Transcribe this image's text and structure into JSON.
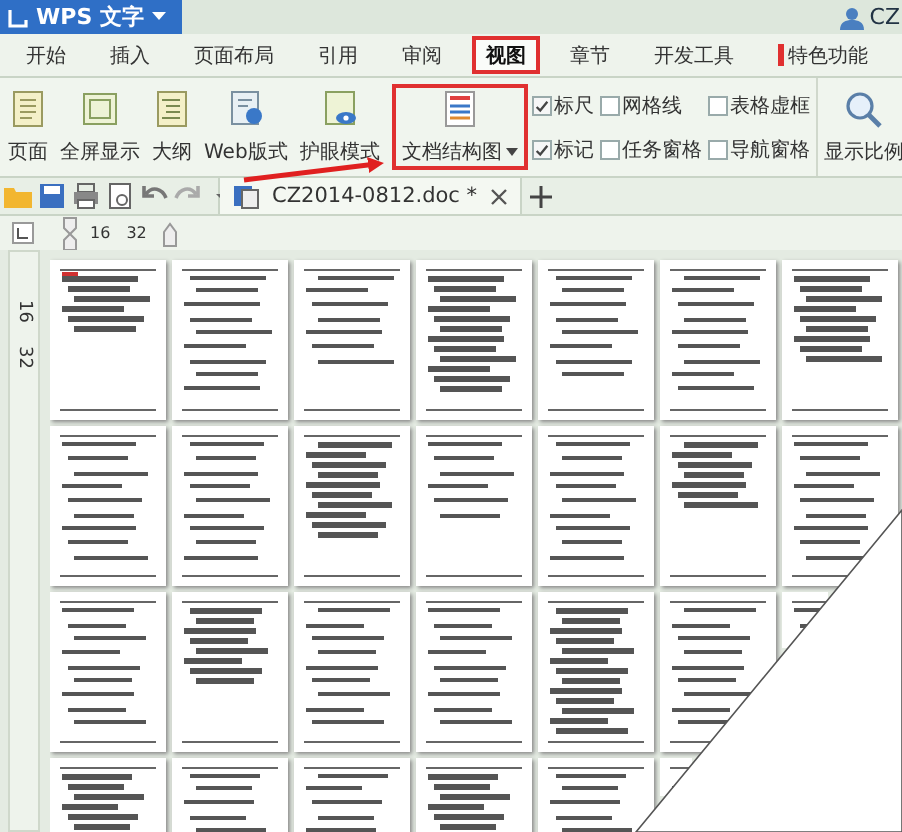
{
  "app": {
    "title": "WPS 文字",
    "user": "CZ"
  },
  "menu_tabs": [
    {
      "label": "开始",
      "selected": false,
      "highlighted": false,
      "flagged": false
    },
    {
      "label": "插入",
      "selected": false,
      "highlighted": false,
      "flagged": false
    },
    {
      "label": "页面布局",
      "selected": false,
      "highlighted": false,
      "flagged": false
    },
    {
      "label": "引用",
      "selected": false,
      "highlighted": false,
      "flagged": false
    },
    {
      "label": "审阅",
      "selected": false,
      "highlighted": false,
      "flagged": false
    },
    {
      "label": "视图",
      "selected": true,
      "highlighted": true,
      "flagged": false
    },
    {
      "label": "章节",
      "selected": false,
      "highlighted": false,
      "flagged": false
    },
    {
      "label": "开发工具",
      "selected": false,
      "highlighted": false,
      "flagged": false
    },
    {
      "label": "特色功能",
      "selected": false,
      "highlighted": false,
      "flagged": true
    }
  ],
  "ribbon": {
    "buttons": [
      {
        "label": "页面",
        "highlighted": false
      },
      {
        "label": "全屏显示",
        "highlighted": false
      },
      {
        "label": "大纲",
        "highlighted": false
      },
      {
        "label": "Web版式",
        "highlighted": false
      },
      {
        "label": "护眼模式",
        "highlighted": false
      },
      {
        "label": "文档结构图",
        "highlighted": true
      }
    ],
    "checkboxes": [
      {
        "label": "标尺",
        "checked": true
      },
      {
        "label": "网格线",
        "checked": false
      },
      {
        "label": "表格虚框",
        "checked": false
      },
      {
        "label": "标记",
        "checked": true
      },
      {
        "label": "任务窗格",
        "checked": false
      },
      {
        "label": "导航窗格",
        "checked": false
      }
    ],
    "zoom_button": "显示比例"
  },
  "document_tab": {
    "title": "CZ2014-0812.doc *"
  },
  "ruler": {
    "labels": [
      "16",
      "32"
    ]
  },
  "vertical_ruler": {
    "labels": [
      "16",
      "32"
    ]
  }
}
